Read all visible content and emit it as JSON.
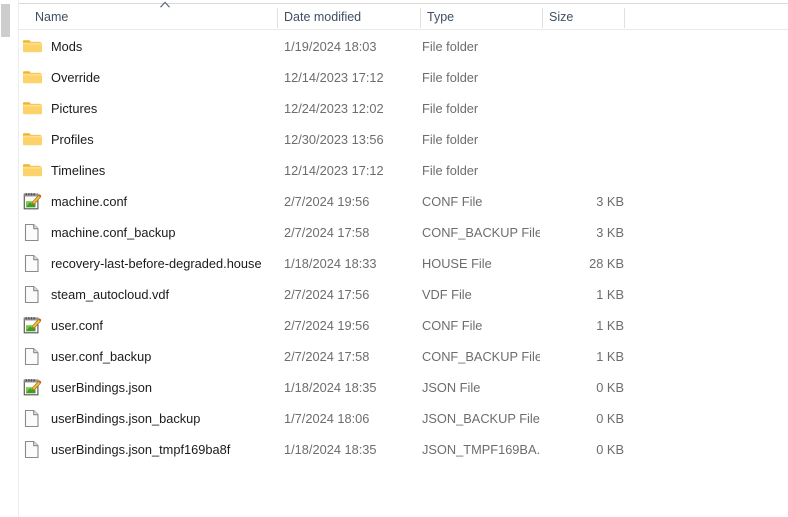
{
  "window": {
    "view": "details-list",
    "sort_column": "Name",
    "sort_direction": "ascending"
  },
  "columns": [
    {
      "key": "name",
      "label": "Name"
    },
    {
      "key": "date",
      "label": "Date modified"
    },
    {
      "key": "type",
      "label": "Type"
    },
    {
      "key": "size",
      "label": "Size"
    }
  ],
  "icons": {
    "folder": "folder-icon",
    "conf": "notepad-edit-file-icon",
    "generic": "generic-file-icon",
    "sort": "sort-ascending-icon"
  },
  "rows": [
    {
      "name": "Mods",
      "date": "1/19/2024 18:03",
      "type": "File folder",
      "size": "",
      "icon": "folder"
    },
    {
      "name": "Override",
      "date": "12/14/2023 17:12",
      "type": "File folder",
      "size": "",
      "icon": "folder"
    },
    {
      "name": "Pictures",
      "date": "12/24/2023 12:02",
      "type": "File folder",
      "size": "",
      "icon": "folder"
    },
    {
      "name": "Profiles",
      "date": "12/30/2023 13:56",
      "type": "File folder",
      "size": "",
      "icon": "folder"
    },
    {
      "name": "Timelines",
      "date": "12/14/2023 17:12",
      "type": "File folder",
      "size": "",
      "icon": "folder"
    },
    {
      "name": "machine.conf",
      "date": "2/7/2024 19:56",
      "type": "CONF File",
      "size": "3 KB",
      "icon": "conf"
    },
    {
      "name": "machine.conf_backup",
      "date": "2/7/2024 17:58",
      "type": "CONF_BACKUP File",
      "size": "3 KB",
      "icon": "generic"
    },
    {
      "name": "recovery-last-before-degraded.house",
      "date": "1/18/2024 18:33",
      "type": "HOUSE File",
      "size": "28 KB",
      "icon": "generic"
    },
    {
      "name": "steam_autocloud.vdf",
      "date": "2/7/2024 17:56",
      "type": "VDF File",
      "size": "1 KB",
      "icon": "generic"
    },
    {
      "name": "user.conf",
      "date": "2/7/2024 19:56",
      "type": "CONF File",
      "size": "1 KB",
      "icon": "conf"
    },
    {
      "name": "user.conf_backup",
      "date": "2/7/2024 17:58",
      "type": "CONF_BACKUP File",
      "size": "1 KB",
      "icon": "generic"
    },
    {
      "name": "userBindings.json",
      "date": "1/18/2024 18:35",
      "type": "JSON File",
      "size": "0 KB",
      "icon": "conf"
    },
    {
      "name": "userBindings.json_backup",
      "date": "1/7/2024 18:06",
      "type": "JSON_BACKUP File",
      "size": "0 KB",
      "icon": "generic"
    },
    {
      "name": "userBindings.json_tmpf169ba8f",
      "date": "1/18/2024 18:35",
      "type": "JSON_TMPF169BA...",
      "size": "0 KB",
      "icon": "generic"
    }
  ],
  "colors": {
    "folder_body": "#fcd26a",
    "folder_tab": "#f7b733",
    "header_text": "#3f4f63",
    "row_text": "#1b1b1b",
    "meta_text": "#6d6d6d",
    "scrollbar_thumb": "#cdcdcd"
  }
}
